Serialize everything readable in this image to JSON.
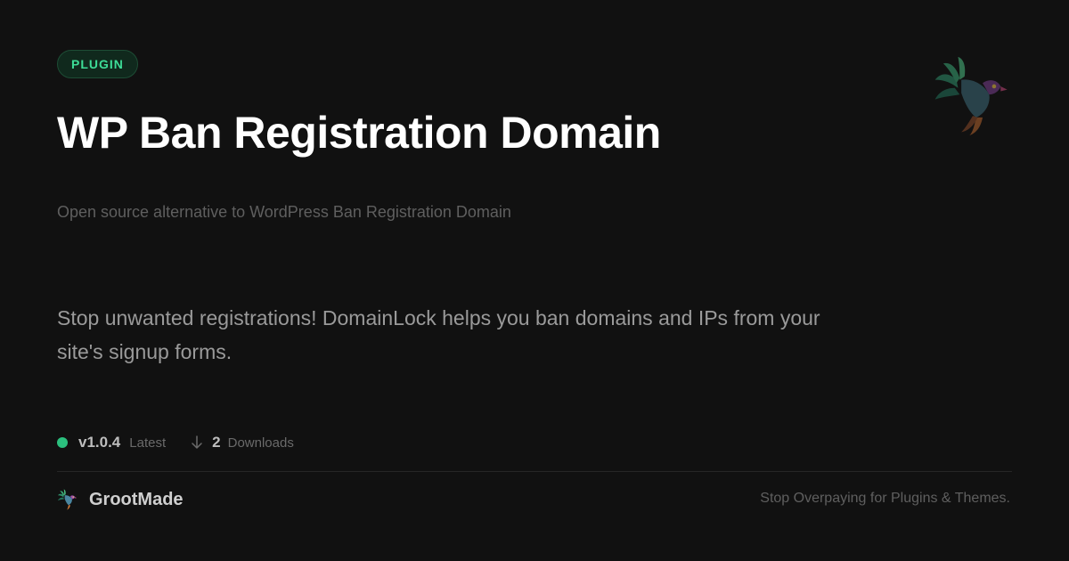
{
  "badge": {
    "label": "PLUGIN"
  },
  "header": {
    "title": "WP Ban Registration Domain",
    "subtitle": "Open source alternative to WordPress Ban Registration Domain"
  },
  "description": "Stop unwanted registrations! DomainLock helps you ban domains and IPs from your site's signup forms.",
  "meta": {
    "version": "v1.0.4",
    "version_tag": "Latest",
    "download_count": "2",
    "downloads_label": "Downloads",
    "status_color": "#2bc07e",
    "download_icon": "arrow-down-icon"
  },
  "footer": {
    "brand_name": "GrootMade",
    "brand_icon": "bird-logo-icon",
    "tagline": "Stop Overpaying for Plugins & Themes."
  },
  "colors": {
    "background": "#111111",
    "accent": "#3ddc97",
    "title": "#ffffff",
    "muted_text": "#5f5f5f"
  },
  "decoration": {
    "icon": "bird-logo-icon"
  }
}
